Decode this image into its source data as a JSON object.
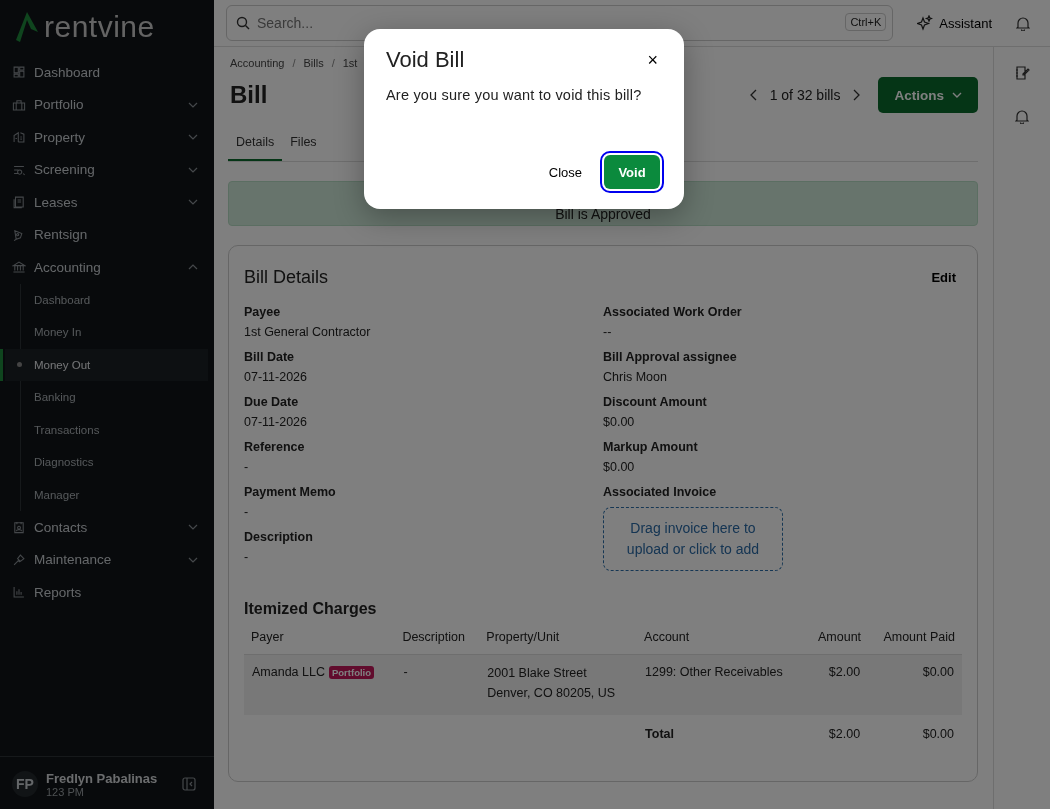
{
  "sidebar": {
    "logo": "rentvine",
    "items": [
      {
        "label": "Dashboard"
      },
      {
        "label": "Portfolio",
        "expanded": false
      },
      {
        "label": "Property",
        "expanded": false
      },
      {
        "label": "Screening",
        "expanded": false
      },
      {
        "label": "Leases",
        "expanded": false
      },
      {
        "label": "Rentsign"
      },
      {
        "label": "Accounting",
        "expanded": true,
        "children": [
          {
            "label": "Dashboard",
            "selected": false
          },
          {
            "label": "Money In",
            "selected": false
          },
          {
            "label": "Money Out",
            "selected": true
          },
          {
            "label": "Banking",
            "selected": false
          },
          {
            "label": "Transactions",
            "selected": false
          },
          {
            "label": "Diagnostics",
            "selected": false
          },
          {
            "label": "Manager",
            "selected": false
          }
        ]
      },
      {
        "label": "Contacts",
        "expanded": false
      },
      {
        "label": "Maintenance",
        "expanded": false
      },
      {
        "label": "Reports"
      }
    ],
    "user": {
      "initials": "FP",
      "name": "Fredlyn Pabalinas",
      "subtitle": "123 PM"
    }
  },
  "topbar": {
    "search": {
      "placeholder": "Search...",
      "shortcut": "Ctrl+K"
    },
    "assistant": "Assistant"
  },
  "breadcrumbs": [
    "Accounting",
    "Bills",
    "1st"
  ],
  "breadcrumb_separator": "/",
  "page": {
    "title": "Bill",
    "pager": "1 of 32 bills",
    "actions": "Actions"
  },
  "tabs": [
    {
      "label": "Details",
      "selected": true
    },
    {
      "label": "Files",
      "selected": false
    }
  ],
  "banner": "Bill is Approved",
  "details": {
    "title": "Bill Details",
    "edit": "Edit",
    "left": [
      {
        "label": "Payee",
        "value": "1st General Contractor"
      },
      {
        "label": "Bill Date",
        "value": "07-11-2026"
      },
      {
        "label": "Due Date",
        "value": "07-11-2026"
      },
      {
        "label": "Reference",
        "value": "-"
      },
      {
        "label": "Payment Memo",
        "value": "-"
      },
      {
        "label": "Description",
        "value": "-"
      }
    ],
    "right": [
      {
        "label": "Associated Work Order",
        "value": "--"
      },
      {
        "label": "Bill Approval assignee",
        "value": "Chris Moon"
      },
      {
        "label": "Discount Amount",
        "value": "$0.00"
      },
      {
        "label": "Markup Amount",
        "value": "$0.00"
      },
      {
        "label": "Associated Invoice",
        "dropzone": "Drag invoice here to upload or click to add"
      }
    ]
  },
  "charges": {
    "title": "Itemized Charges",
    "columns": [
      "Payer",
      "Description",
      "Property/Unit",
      "Account",
      "Amount",
      "Amount Paid"
    ],
    "rows": [
      {
        "payer": "Amanda LLC",
        "tag": "Portfolio",
        "description": "-",
        "property": [
          "2001 Blake Street",
          "Denver, CO 80205, US"
        ],
        "account": "1299: Other Receivables",
        "amount": "$2.00",
        "paid": "$0.00"
      }
    ],
    "total": {
      "label": "Total",
      "amount": "$2.00",
      "paid": "$0.00"
    }
  },
  "dialog": {
    "title": "Void Bill",
    "close_icon": "×",
    "message": "Are you sure you want to void this bill?",
    "buttons": [
      "Close",
      "Void"
    ]
  }
}
